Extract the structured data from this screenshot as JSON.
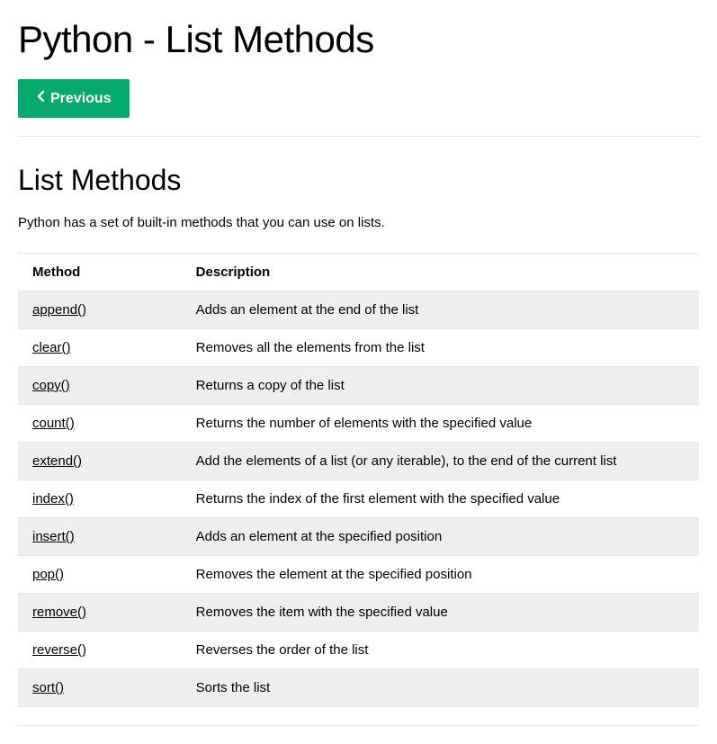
{
  "page_title": "Python - List Methods",
  "nav": {
    "previous_label": "Previous"
  },
  "section": {
    "heading": "List Methods",
    "intro": "Python has a set of built-in methods that you can use on lists."
  },
  "table": {
    "headers": {
      "method": "Method",
      "description": "Description"
    },
    "rows": [
      {
        "method": "append()",
        "description": "Adds an element at the end of the list"
      },
      {
        "method": "clear()",
        "description": "Removes all the elements from the list"
      },
      {
        "method": "copy()",
        "description": "Returns a copy of the list"
      },
      {
        "method": "count()",
        "description": "Returns the number of elements with the specified value"
      },
      {
        "method": "extend()",
        "description": "Add the elements of a list (or any iterable), to the end of the current list"
      },
      {
        "method": "index()",
        "description": "Returns the index of the first element with the specified value"
      },
      {
        "method": "insert()",
        "description": "Adds an element at the specified position"
      },
      {
        "method": "pop()",
        "description": "Removes the element at the specified position"
      },
      {
        "method": "remove()",
        "description": "Removes the item with the specified value"
      },
      {
        "method": "reverse()",
        "description": "Reverses the order of the list"
      },
      {
        "method": "sort()",
        "description": "Sorts the list"
      }
    ]
  }
}
